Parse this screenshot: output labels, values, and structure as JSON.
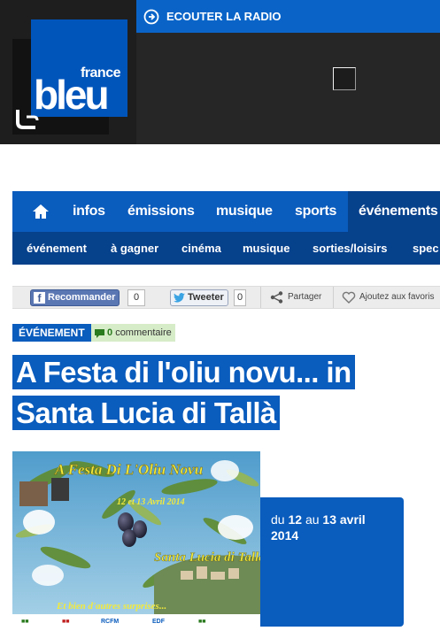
{
  "header": {
    "logo_top": "france",
    "logo_main": "bleu",
    "radio_label": "ECOUTER LA RADIO"
  },
  "nav": {
    "main": [
      "infos",
      "émissions",
      "musique",
      "sports",
      "événements"
    ],
    "active": "événements",
    "sub": [
      "événement",
      "à gagner",
      "cinéma",
      "musique",
      "sorties/loisirs",
      "spec"
    ]
  },
  "social": {
    "recommend_label": "Recommander",
    "recommend_count": "0",
    "tweet_label": "Tweeter",
    "tweet_count": "0",
    "share_label": "Partager",
    "favorites_label": "Ajoutez aux favoris"
  },
  "article": {
    "tag": "ÉVÉNEMENT",
    "comment_count": "0",
    "comment_label": "commentaire",
    "title_line1": "A Festa di l'oliu novu... in",
    "title_line2": "Santa Lucia di Tallà",
    "date_prefix": "du",
    "date_start": "12",
    "date_mid": "au",
    "date_end": "13 avril",
    "date_year": "2014"
  },
  "poster": {
    "headline": "A Festa Di L'Oliu Novu",
    "dates": "12 et 13 Avril 2014",
    "place": "Santa Lucia di Tallà",
    "footer": "Et bien d'autres surprises...",
    "sponsors": [
      "EDF",
      "RCFM",
      "CORSE MATIN"
    ]
  },
  "colors": {
    "brand_blue": "#0a5cbd",
    "dark_blue": "#06418c",
    "header_dark": "#2f2f2f"
  }
}
